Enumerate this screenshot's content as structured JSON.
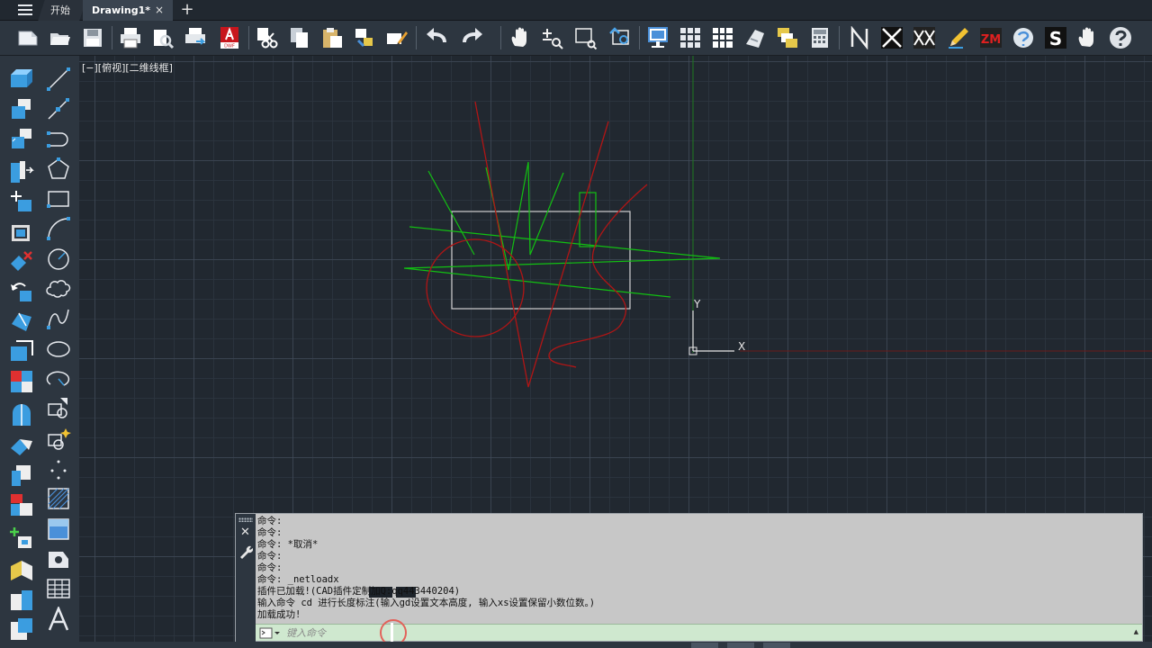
{
  "tabs": {
    "start": "开始",
    "drawing": "Drawing1*",
    "close": "×",
    "add": "+"
  },
  "toolbar_icons": [
    "new-icon",
    "open-icon",
    "save-icon",
    "print-icon",
    "print-preview-icon",
    "plot-icon",
    "dwf-export-icon",
    "cut-icon",
    "copy-icon",
    "paste-icon",
    "match-properties-icon",
    "block-editor-icon",
    "undo-icon",
    "redo-icon",
    "pan-icon",
    "zoom-realtime-icon",
    "zoom-window-icon",
    "zoom-previous-icon",
    "properties-icon",
    "design-center-icon",
    "tool-palette-icon",
    "sheet-set-icon",
    "markup-icon",
    "calculator-icon",
    "plugin-n-icon",
    "plugin-cross-icon",
    "plugin-xx-icon",
    "plugin-pencil-icon",
    "plugin-zm-icon",
    "plugin-s-logo-icon",
    "plugin-s-icon",
    "plugin-hand-icon",
    "help-icon"
  ],
  "viewport": {
    "label": "[−][俯视][二维线框]"
  },
  "ucs": {
    "x": "X",
    "y": "Y"
  },
  "command": {
    "close": "✕",
    "history": [
      "命令:",
      "命令:",
      "命令: *取消*",
      "命令:",
      "命令:",
      "命令: _netloadx",
      "插件已加载!(CAD插件定制加Q:qq443440204)",
      "输入命令 cd 进行长度标注(输入gd设置文本高度, 输入xs设置保留小数位数。)",
      "加载成功!"
    ],
    "input_placeholder": "键入命令"
  },
  "colors": {
    "canvas": "#212830",
    "chrome": "#2d3640",
    "red": "#b01515",
    "green": "#12c012",
    "white": "#d0d0d0",
    "command_bg": "#c7c7c7",
    "input_bg": "#cfe8cf"
  }
}
